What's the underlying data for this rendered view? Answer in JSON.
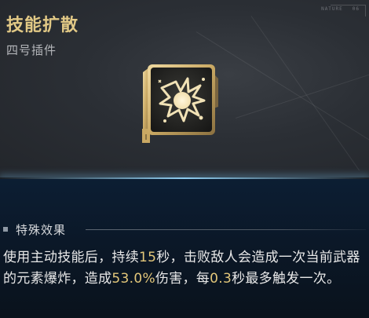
{
  "skill": {
    "name": "技能扩散",
    "slot": "四号插件",
    "icon": "explosion-burst-icon"
  },
  "corner_tag": {
    "code": "NATURE",
    "index": "06"
  },
  "effect": {
    "header": "特殊效果",
    "parts": [
      "使用主动技能后，持续",
      "15",
      "秒，击败敌人会造成一次当前武器的元素爆炸，造成",
      "53.0%",
      "伤害，每",
      "0.3",
      "秒最多触发一次。"
    ]
  },
  "colors": {
    "title": "#e2c986",
    "highlight": "#e3c77a",
    "divider_glow": "#8fcdf0",
    "top_panel": "#2b2f35",
    "bottom_panel": "#0b1828"
  }
}
